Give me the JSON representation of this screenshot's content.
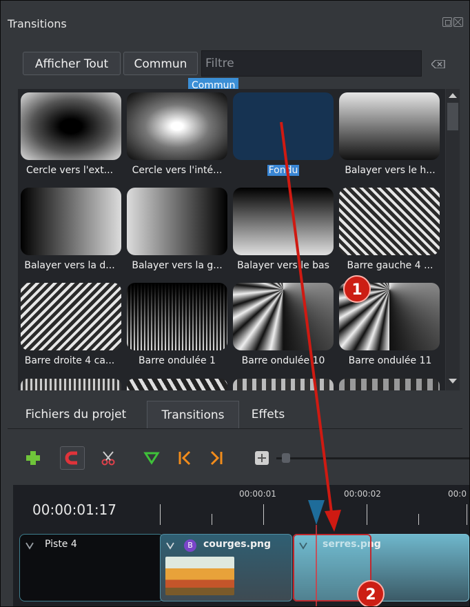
{
  "panel": {
    "title": "Transitions"
  },
  "toolbar_top": {
    "show_all": "Afficher Tout",
    "common": "Commun",
    "filter_placeholder": "Filtre",
    "tooltip": "Commun"
  },
  "transitions": [
    {
      "label": "Cercle vers l'ext...",
      "style": "radial-out"
    },
    {
      "label": "Cercle vers l'inté...",
      "style": "radial-in"
    },
    {
      "label": "Fondu",
      "style": "solid",
      "selected": true
    },
    {
      "label": "Balayer vers le h...",
      "style": "wipe-up"
    },
    {
      "label": "Balayer vers la d...",
      "style": "wipe-right"
    },
    {
      "label": "Balayer vers la g...",
      "style": "wipe-left"
    },
    {
      "label": "Balayer vers le bas",
      "style": "wipe-down"
    },
    {
      "label": "Barre gauche 4 ...",
      "style": "stripes-left"
    },
    {
      "label": "Barre droite 4 ca...",
      "style": "stripes-right"
    },
    {
      "label": "Barre ondulée 1",
      "style": "wavy-1"
    },
    {
      "label": "Barre ondulée 10",
      "style": "wavy-10"
    },
    {
      "label": "Barre ondulée 11",
      "style": "wavy-11"
    }
  ],
  "tabs": [
    {
      "label": "Fichiers du projet"
    },
    {
      "label": "Transitions",
      "active": true
    },
    {
      "label": "Effets"
    }
  ],
  "timeline": {
    "current_time": "00:00:01:17",
    "ruler": [
      "00:00:01",
      "00:00:02",
      "00:0"
    ],
    "track_name": "Piste 4",
    "clips": [
      {
        "name": "courges.png",
        "badge": "B"
      },
      {
        "name": "serres.png"
      }
    ]
  },
  "callouts": [
    "1",
    "2"
  ],
  "colors": {
    "accent": "#3a86d4",
    "callout": "#cc1e14",
    "arrow": "#d11a12"
  }
}
